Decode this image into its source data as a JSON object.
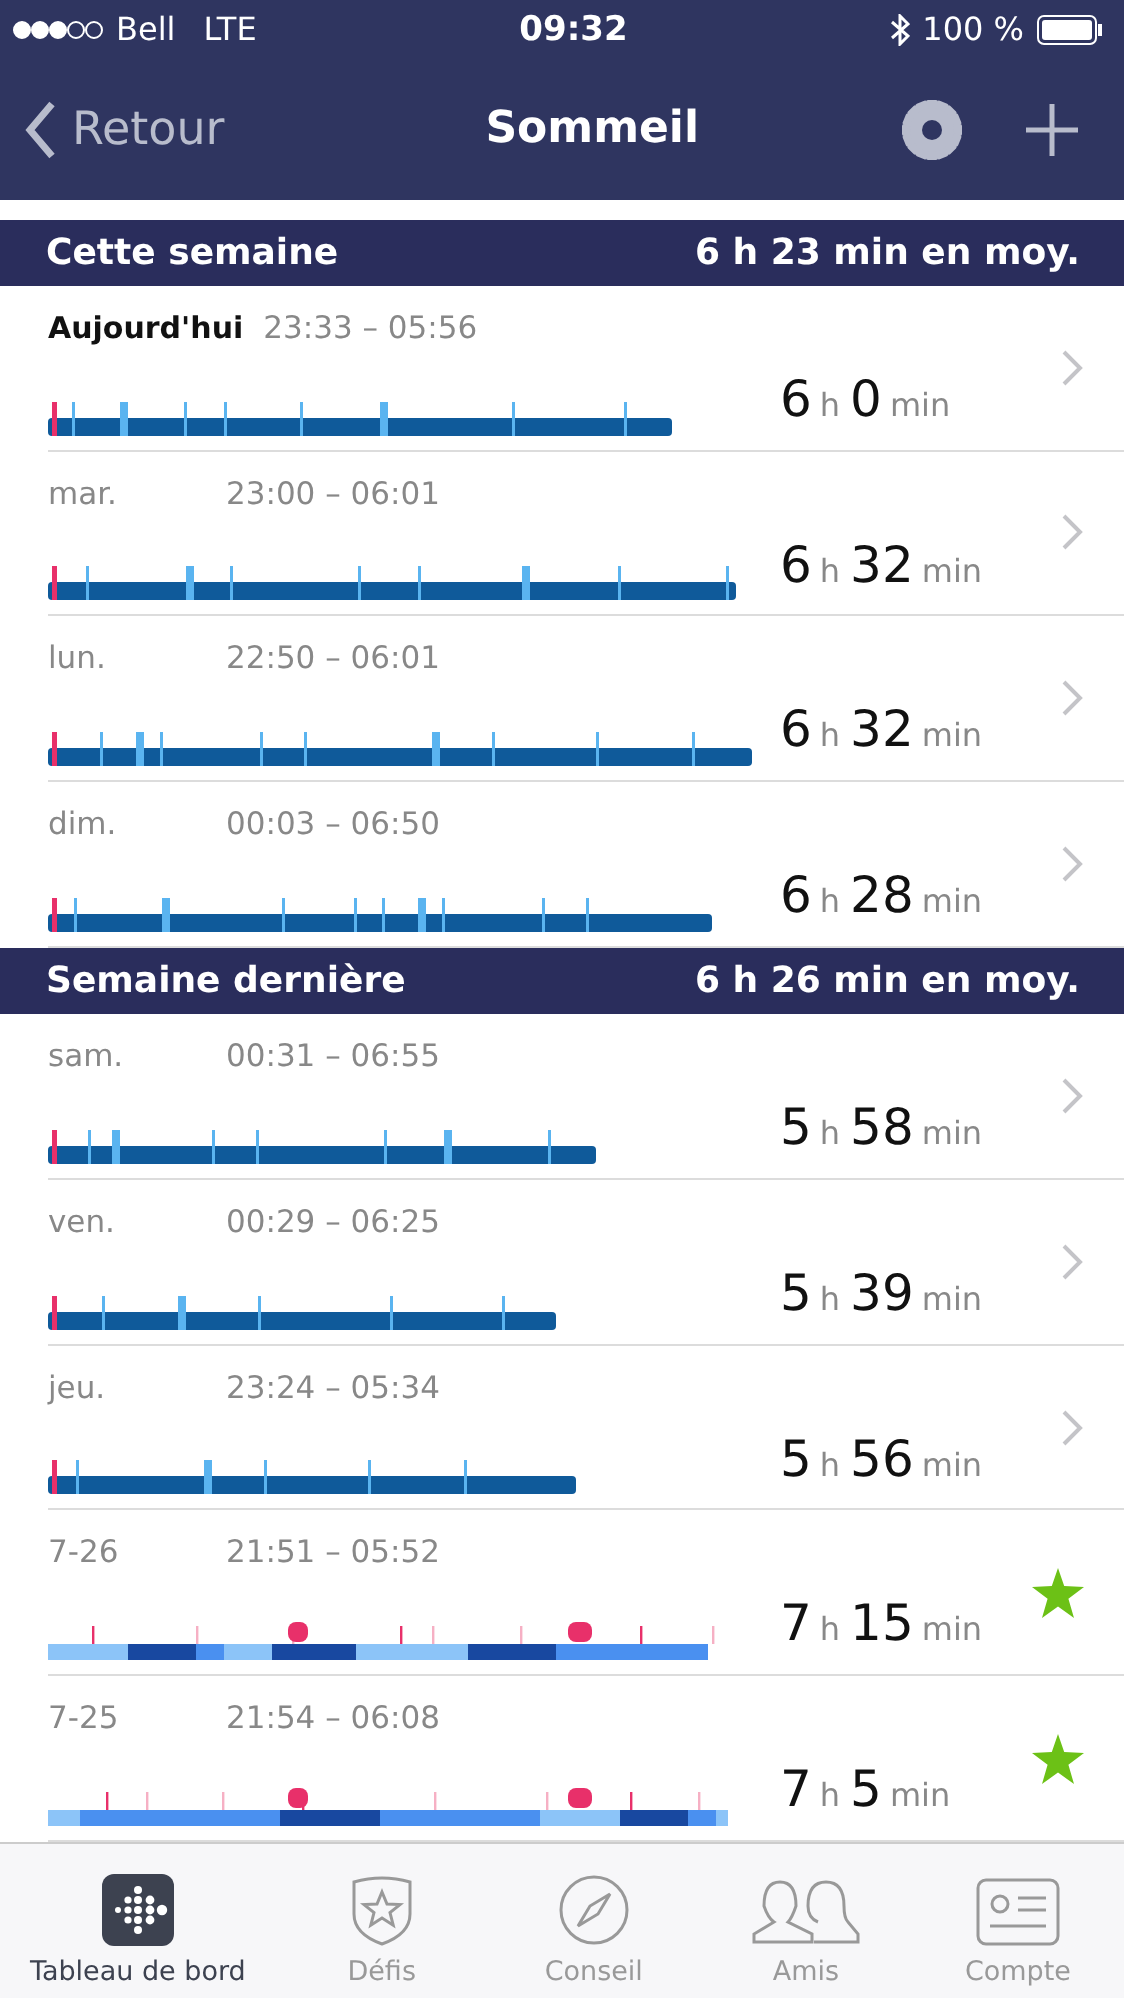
{
  "status_bar": {
    "carrier": "Bell",
    "network": "LTE",
    "time": "09:32",
    "battery": "100 %"
  },
  "nav": {
    "back": "Retour",
    "title": "Sommeil"
  },
  "sections": [
    {
      "title": "Cette semaine",
      "average": "6 h 23 min en moy.",
      "rows": [
        {
          "day": "Aujourd'hui",
          "today": true,
          "times": "23:33 – 05:56",
          "hours": "6",
          "hours_unit": "h",
          "minutes": "0",
          "minutes_unit": "min",
          "kind": "classic"
        },
        {
          "day": "mar.",
          "today": false,
          "times": "23:00 – 06:01",
          "hours": "6",
          "hours_unit": "h",
          "minutes": "32",
          "minutes_unit": "min",
          "kind": "classic"
        },
        {
          "day": "lun.",
          "today": false,
          "times": "22:50 – 06:01",
          "hours": "6",
          "hours_unit": "h",
          "minutes": "32",
          "minutes_unit": "min",
          "kind": "classic"
        },
        {
          "day": "dim.",
          "today": false,
          "times": "00:03 – 06:50",
          "hours": "6",
          "hours_unit": "h",
          "minutes": "28",
          "minutes_unit": "min",
          "kind": "classic"
        }
      ]
    },
    {
      "title": "Semaine dernière",
      "average": "6 h 26 min en moy.",
      "rows": [
        {
          "day": "sam.",
          "today": false,
          "times": "00:31 – 06:55",
          "hours": "5",
          "hours_unit": "h",
          "minutes": "58",
          "minutes_unit": "min",
          "kind": "classic"
        },
        {
          "day": "ven.",
          "today": false,
          "times": "00:29 – 06:25",
          "hours": "5",
          "hours_unit": "h",
          "minutes": "39",
          "minutes_unit": "min",
          "kind": "classic"
        },
        {
          "day": "jeu.",
          "today": false,
          "times": "23:24 – 05:34",
          "hours": "5",
          "hours_unit": "h",
          "minutes": "56",
          "minutes_unit": "min",
          "kind": "classic"
        },
        {
          "day": "7-26",
          "today": false,
          "times": "21:51 – 05:52",
          "hours": "7",
          "hours_unit": "h",
          "minutes": "15",
          "minutes_unit": "min",
          "kind": "stages"
        },
        {
          "day": "7-25",
          "today": false,
          "times": "21:54 – 06:08",
          "hours": "7",
          "hours_unit": "h",
          "minutes": "5",
          "minutes_unit": "min",
          "kind": "stages"
        }
      ]
    }
  ],
  "tabs": [
    {
      "label": "Tableau de bord",
      "selected": true
    },
    {
      "label": "Défis",
      "selected": false
    },
    {
      "label": "Conseil",
      "selected": false
    },
    {
      "label": "Amis",
      "selected": false
    },
    {
      "label": "Compte",
      "selected": false
    }
  ]
}
